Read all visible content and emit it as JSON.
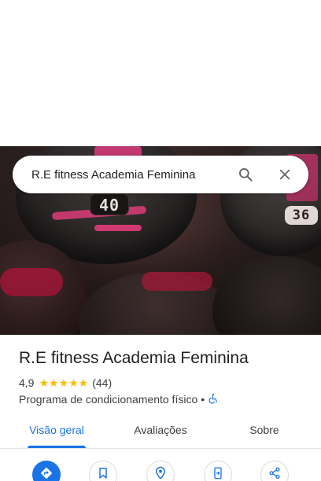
{
  "search": {
    "query": "R.E fitness Academia Feminina"
  },
  "hero": {
    "weight_label_1": "40",
    "weight_label_2": "36"
  },
  "place": {
    "name": "R.E fitness Academia Feminina",
    "rating": "4,9",
    "stars": "★★★★★",
    "review_count": "(44)",
    "category": "Programa de condicionamento físico",
    "separator": "•"
  },
  "tabs": [
    {
      "label": "Visão geral",
      "active": true
    },
    {
      "label": "Avaliações",
      "active": false
    },
    {
      "label": "Sobre",
      "active": false
    }
  ],
  "actions": [
    {
      "icon": "directions-icon"
    },
    {
      "icon": "bookmark-icon"
    },
    {
      "icon": "nearby-icon"
    },
    {
      "icon": "send-to-phone-icon"
    },
    {
      "icon": "share-icon"
    }
  ],
  "colors": {
    "accent": "#1a73e8",
    "star": "#fbbc04",
    "text": "#202124"
  }
}
